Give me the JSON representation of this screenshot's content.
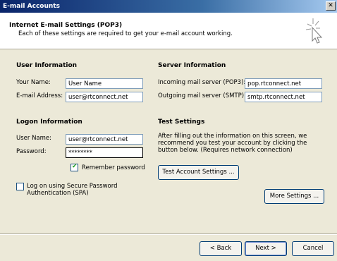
{
  "window": {
    "title": "E-mail Accounts",
    "close_glyph": "✕"
  },
  "header": {
    "title": "Internet E-mail Settings (POP3)",
    "subtitle": "Each of these settings are required to get your e-mail account working."
  },
  "user_info": {
    "heading": "User Information",
    "name_label": "Your Name:",
    "name_value": "User Name",
    "email_label": "E-mail Address:",
    "email_value": "user@rtconnect.net"
  },
  "server_info": {
    "heading": "Server Information",
    "incoming_label": "Incoming mail server (POP3):",
    "incoming_value": "pop.rtconnect.net",
    "outgoing_label": "Outgoing mail server (SMTP):",
    "outgoing_value": "smtp.rtconnect.net"
  },
  "logon_info": {
    "heading": "Logon Information",
    "username_label": "User Name:",
    "username_value": "user@rtconnect.net",
    "password_label": "Password:",
    "password_value": "********",
    "remember_label": "Remember password",
    "remember_checked": true,
    "spa_label_line1": "Log on using Secure Password",
    "spa_label_line2": "Authentication (SPA)",
    "spa_checked": false
  },
  "test_settings": {
    "heading": "Test Settings",
    "note_line1": "After filling out the information on this screen, we",
    "note_line2": "recommend you test your account by clicking the",
    "note_line3": "button below. (Requires network connection)",
    "test_button": "Test Account Settings ..."
  },
  "buttons": {
    "more_settings": "More Settings ...",
    "back": "< Back",
    "next": "Next >",
    "cancel": "Cancel"
  },
  "icons": {
    "wizard": "cursor-sparkle-icon",
    "close": "close-icon"
  }
}
